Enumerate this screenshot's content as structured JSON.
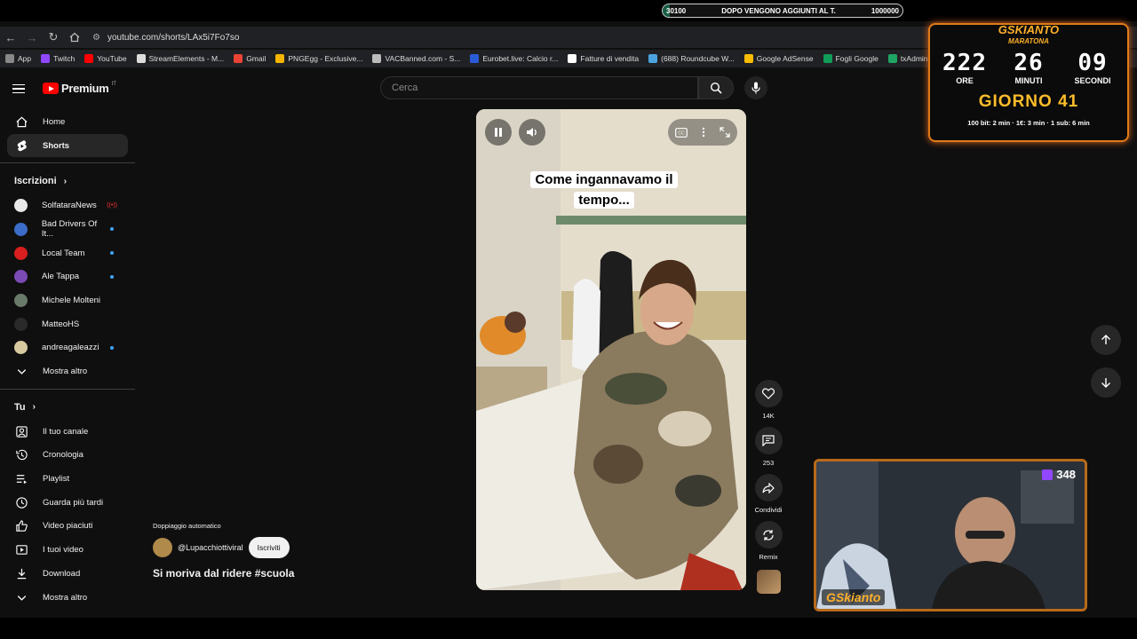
{
  "donation": {
    "current": "30100",
    "message": "DOPO VENGONO AGGIUNTI AL T.",
    "goal": "1000000",
    "fill_fraction": 0.03
  },
  "browser": {
    "url": "youtube.com/shorts/LAx5i7Fo7so",
    "bookmarks": [
      {
        "label": "App",
        "color": "#888888"
      },
      {
        "label": "Twitch",
        "color": "#9146ff"
      },
      {
        "label": "YouTube",
        "color": "#ff0000"
      },
      {
        "label": "StreamElements - M...",
        "color": "#dddddd"
      },
      {
        "label": "Gmail",
        "color": "#ea4335"
      },
      {
        "label": "PNGEgg - Exclusive...",
        "color": "#f7b500"
      },
      {
        "label": "VACBanned.com - S...",
        "color": "#bbbbbb"
      },
      {
        "label": "Eurobet.live: Calcio r...",
        "color": "#2a5bd7"
      },
      {
        "label": "Fatture di vendita",
        "color": "#ffffff"
      },
      {
        "label": "(688) Roundcube W...",
        "color": "#4aa3df"
      },
      {
        "label": "Google AdSense",
        "color": "#fbbc05"
      },
      {
        "label": "Fogli Google",
        "color": "#0f9d58"
      },
      {
        "label": "txAdmin",
        "color": "#1fa463"
      }
    ]
  },
  "youtube": {
    "logo_text": "Premium",
    "country": "IT",
    "search_placeholder": "Cerca",
    "nav": [
      {
        "label": "Home",
        "icon": "home-icon"
      },
      {
        "label": "Shorts",
        "icon": "shorts-icon",
        "active": true
      }
    ],
    "subscriptions_title": "Iscrizioni",
    "subscriptions": [
      {
        "label": "SolfataraNews",
        "color": "#e8e8e8",
        "badge": "live"
      },
      {
        "label": "Bad Drivers Of It...",
        "color": "#3b6cc7",
        "badge": "dot"
      },
      {
        "label": "Local Team",
        "color": "#d81e1e",
        "badge": "dot"
      },
      {
        "label": "Ale Tappa",
        "color": "#7b4bb5",
        "badge": "dot"
      },
      {
        "label": "Michele Molteni",
        "color": "#6a7a6a",
        "badge": ""
      },
      {
        "label": "MatteoHS",
        "color": "#2a2a2a",
        "badge": ""
      },
      {
        "label": "andreagaleazzi",
        "color": "#d8c9a0",
        "badge": "dot"
      },
      {
        "label": "Mostra altro",
        "color": "",
        "badge": "",
        "chevron": true
      }
    ],
    "you_title": "Tu",
    "you_items": [
      {
        "label": "Il tuo canale",
        "icon": "account-icon"
      },
      {
        "label": "Cronologia",
        "icon": "history-icon"
      },
      {
        "label": "Playlist",
        "icon": "playlist-icon"
      },
      {
        "label": "Guarda più tardi",
        "icon": "clock-icon"
      },
      {
        "label": "Video piaciuti",
        "icon": "thumb-up-icon"
      },
      {
        "label": "I tuoi video",
        "icon": "video-icon"
      },
      {
        "label": "Download",
        "icon": "download-icon"
      },
      {
        "label": "Mostra altro",
        "icon": "chevron-down-icon"
      }
    ],
    "short": {
      "caption_line1": "Come ingannavamo il",
      "caption_line2": "tempo...",
      "likes": "14K",
      "comments": "253",
      "share": "Condividi",
      "remix": "Remix",
      "dub_label": "Doppiaggio automatico",
      "channel": "@Lupacchiottiviral",
      "subscribe": "Iscriviti",
      "title": "Si moriva dal ridere #scuola"
    }
  },
  "overlay": {
    "timer_brand": "GSKIANTO",
    "timer_sub": "MARATONA",
    "hours": "222",
    "minutes": "26",
    "seconds": "09",
    "hours_label": "ORE",
    "minutes_label": "MINUTI",
    "seconds_label": "SECONDI",
    "day": "GIORNO 41",
    "rules": "100 bit: 2 min · 1€: 3 min · 1 sub: 6 min",
    "viewers": "348",
    "cam_logo": "GSkianto"
  }
}
